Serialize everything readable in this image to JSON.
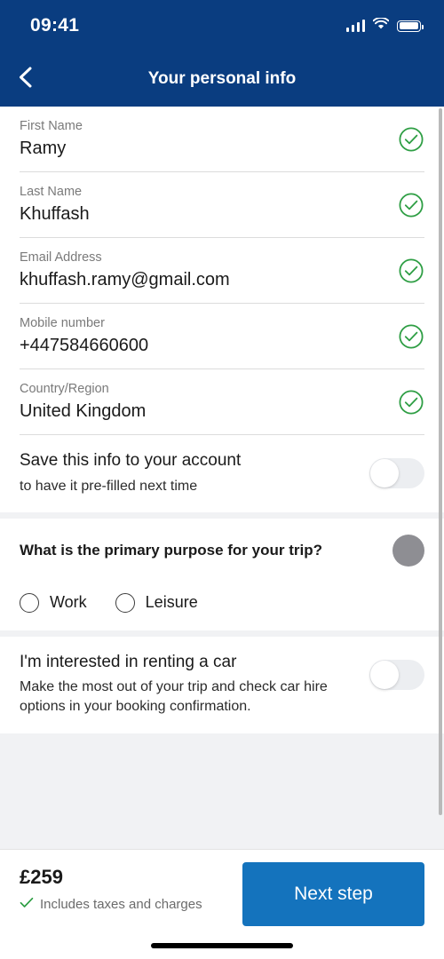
{
  "status_bar": {
    "time": "09:41",
    "cellular_icon": "signal-bars-icon",
    "wifi_icon": "wifi-icon",
    "battery_icon": "battery-icon"
  },
  "navbar": {
    "title": "Your personal info",
    "back_icon": "chevron-left-icon"
  },
  "colors": {
    "header_navy": "#0a3d80",
    "cta_blue": "#1473bd",
    "check_green": "#2e9e44",
    "label_gray": "#7a7a7a",
    "page_bg": "#f1f2f4"
  },
  "form": {
    "fields": [
      {
        "label": "First Name",
        "value": "Ramy",
        "valid_icon": "check-circle-icon"
      },
      {
        "label": "Last Name",
        "value": "Khuffash",
        "valid_icon": "check-circle-icon"
      },
      {
        "label": "Email Address",
        "value": "khuffash.ramy@gmail.com",
        "valid_icon": "check-circle-icon"
      },
      {
        "label": "Mobile number",
        "value": "+447584660600",
        "valid_icon": "check-circle-icon"
      },
      {
        "label": "Country/Region",
        "value": "United Kingdom",
        "valid_icon": "check-circle-icon"
      }
    ],
    "save_info": {
      "title": "Save this info to your account",
      "subtitle": "to have it pre-filled next time",
      "toggle_state": "off"
    }
  },
  "purpose": {
    "question": "What is the primary purpose for your trip?",
    "avatar_icon": "avatar-circle-icon",
    "options": [
      {
        "label": "Work",
        "selected": false
      },
      {
        "label": "Leisure",
        "selected": false
      }
    ]
  },
  "car_rental": {
    "title": "I'm interested in renting a car",
    "description": "Make the most out of your trip and check car hire options in your booking confirmation.",
    "toggle_state": "off"
  },
  "footer": {
    "price": "£259",
    "price_note": "Includes taxes and charges",
    "price_note_icon": "check-icon",
    "next_button": "Next step"
  }
}
